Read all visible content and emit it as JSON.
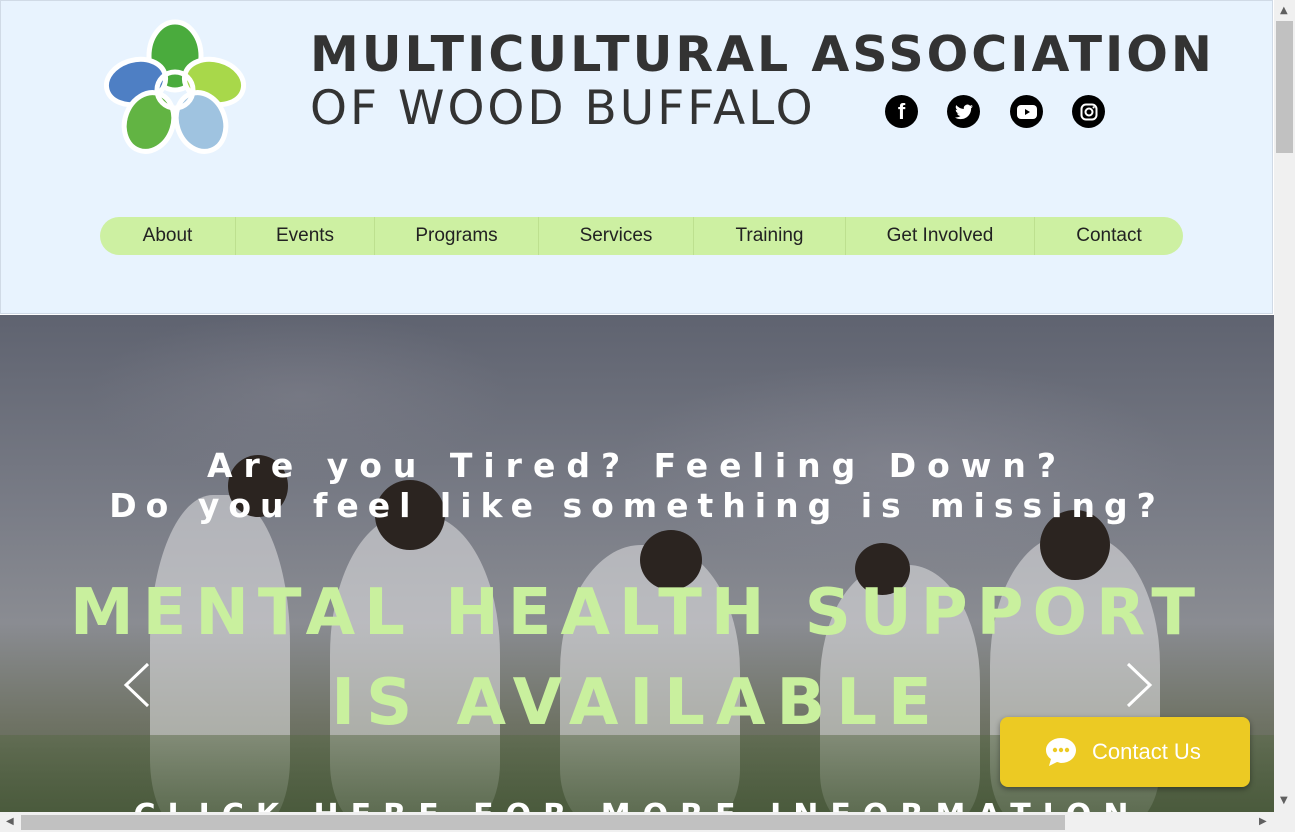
{
  "header": {
    "title_line1": "MULTICULTURAL ASSOCIATION",
    "title_line2": "OF WOOD BUFFALO",
    "social": [
      {
        "name": "facebook-icon",
        "glyph": "f"
      },
      {
        "name": "twitter-icon",
        "glyph": "t"
      },
      {
        "name": "youtube-icon",
        "glyph": "▶"
      },
      {
        "name": "instagram-icon",
        "glyph": "◎"
      }
    ]
  },
  "nav": {
    "items": [
      {
        "label": "About"
      },
      {
        "label": "Events"
      },
      {
        "label": "Programs"
      },
      {
        "label": "Services"
      },
      {
        "label": "Training"
      },
      {
        "label": "Get Involved"
      },
      {
        "label": "Contact"
      }
    ]
  },
  "hero": {
    "line1": "Are you Tired? Feeling Down?",
    "line2": "Do you feel like something is missing?",
    "headline1": "MENTAL HEALTH SUPPORT",
    "headline2": "IS AVAILABLE",
    "cta": "CLICK HERE FOR MORE INFORMATION"
  },
  "chat": {
    "label": "Contact Us"
  },
  "colors": {
    "header_bg": "#e8f3fe",
    "nav_bg": "#cdf0a2",
    "headline": "#c9f09e",
    "chat_button": "#ecca23"
  }
}
